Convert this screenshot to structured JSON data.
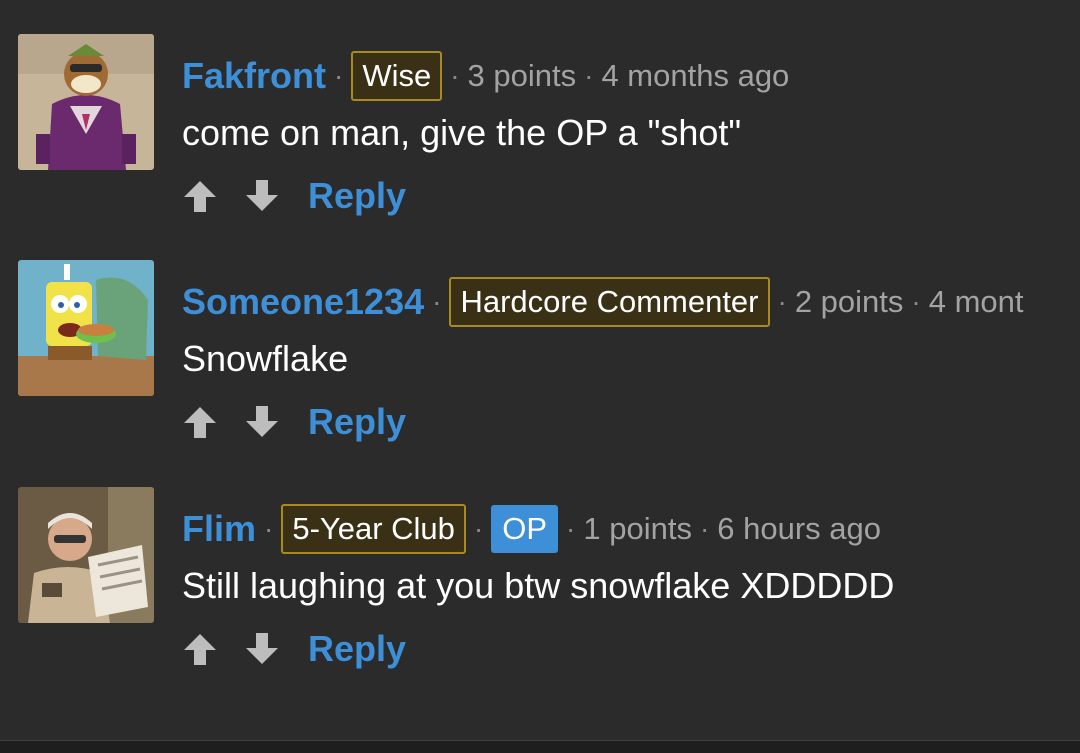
{
  "colors": {
    "background": "#2b2b2b",
    "username": "#3d8fd8",
    "reply": "#3d8fd8",
    "flair_border": "#a88a1f",
    "flair_background": "#3a3015",
    "op_badge": "#3d8fd8",
    "meta_text": "#a3a3a3",
    "vote_arrow": "#bdbdbd"
  },
  "icons": {
    "upvote": "arrow-up-icon",
    "downvote": "arrow-down-icon"
  },
  "comments": [
    {
      "username": "Fakfront",
      "flair": "Wise",
      "points": "3 points",
      "age": "4 months ago",
      "text": "come on man, give the OP a \"shot\"",
      "reply_label": "Reply"
    },
    {
      "username": "Someone1234",
      "flair": "Hardcore Commenter",
      "points": "2 points",
      "age": "4 mont",
      "text": "Snowflake",
      "reply_label": "Reply"
    },
    {
      "username": "Flim",
      "flair": "5-Year Club",
      "op_badge": "OP",
      "points": "1 points",
      "age": "6 hours ago",
      "text": "Still laughing at you btw snowflake XDDDDD",
      "reply_label": "Reply"
    }
  ],
  "separator": "·"
}
